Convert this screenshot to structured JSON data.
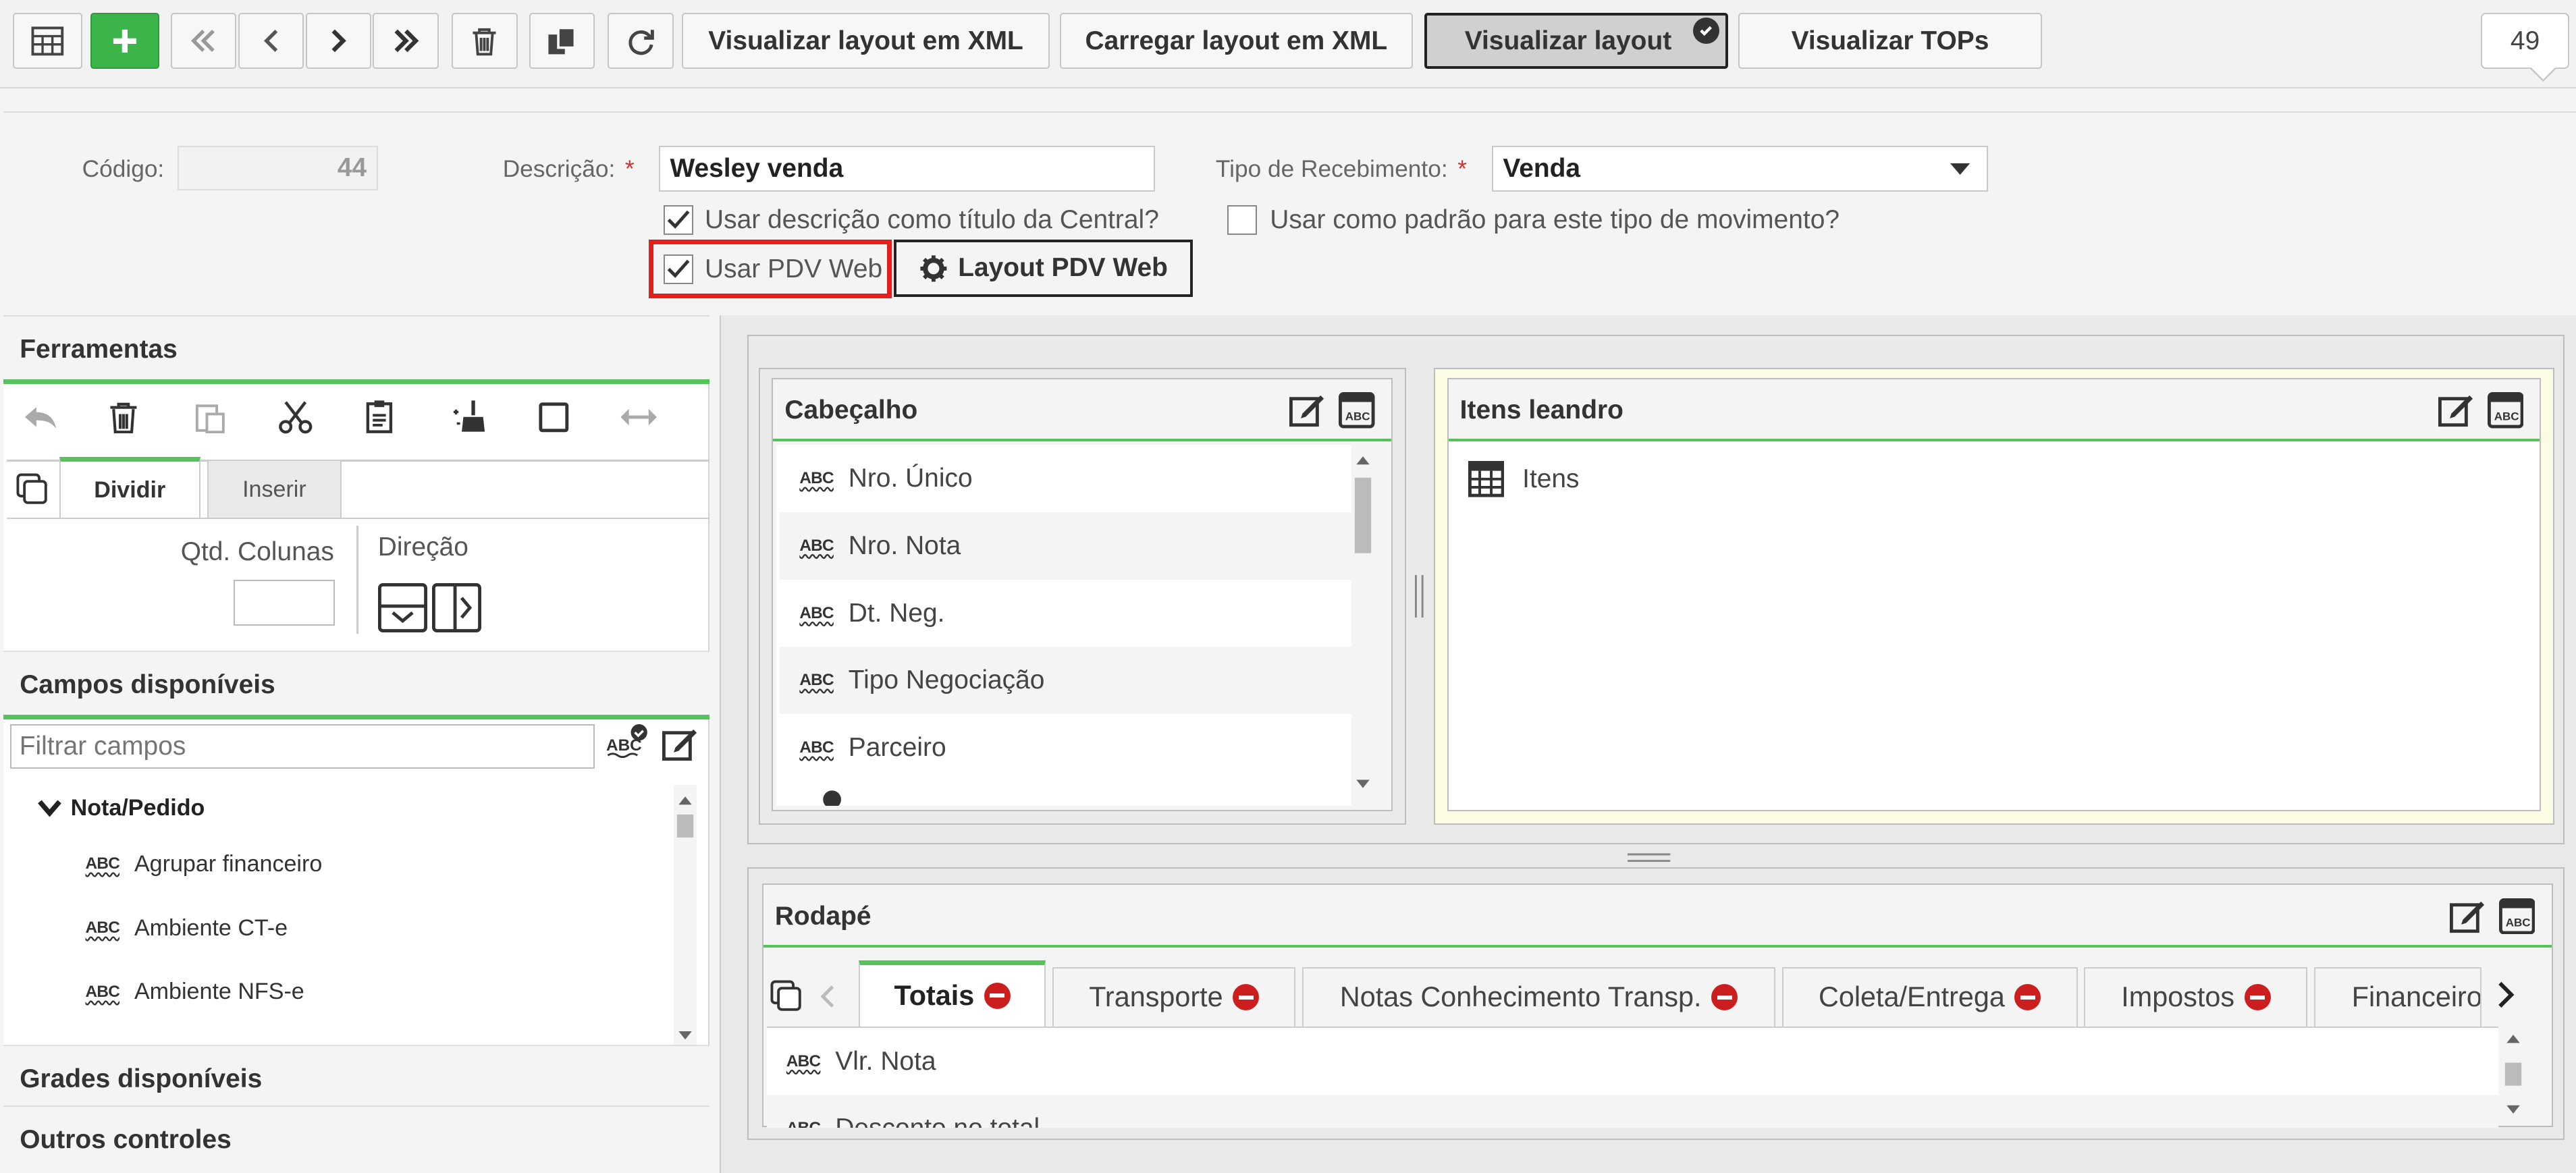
{
  "toolbar": {
    "view_xml_label": "Visualizar layout em XML",
    "load_xml_label": "Carregar layout em XML",
    "view_layout_label": "Visualizar layout",
    "view_tops_label": "Visualizar TOPs",
    "count": "49",
    "icons": [
      "grid-icon",
      "add-icon",
      "first-icon",
      "prev-icon",
      "next-icon",
      "last-icon",
      "trash-icon",
      "copy-icon",
      "refresh-icon"
    ]
  },
  "form": {
    "codigo_label": "Código:",
    "codigo_value": "44",
    "descricao_label": "Descrição:",
    "descricao_value": "Wesley venda",
    "tipo_label": "Tipo de Recebimento:",
    "tipo_value": "Venda",
    "required_mark": "*",
    "chk_titulo": "Usar descrição como título da Central?",
    "chk_padrao": "Usar como padrão para este tipo de movimento?",
    "chk_pdv": "Usar PDV Web",
    "layout_pdv_button": "Layout PDV Web"
  },
  "left": {
    "ferramentas_title": "Ferramentas",
    "tab_dividir": "Dividir",
    "tab_inserir": "Inserir",
    "qtd_colunas_label": "Qtd. Colunas",
    "direcao_label": "Direção",
    "campos_title": "Campos disponíveis",
    "filter_placeholder": "Filtrar campos",
    "group_label": "Nota/Pedido",
    "fields": [
      "Agrupar financeiro",
      "Ambiente CT-e",
      "Ambiente NFS-e"
    ],
    "grades_title": "Grades disponíveis",
    "outros_title": "Outros controles"
  },
  "cabecalho": {
    "title": "Cabeçalho",
    "fields": [
      "Nro. Único",
      "Nro. Nota",
      "Dt. Neg.",
      "Tipo Negociação",
      "Parceiro"
    ]
  },
  "itens": {
    "title": "Itens leandro",
    "item_label": "Itens"
  },
  "rodape": {
    "title": "Rodapé",
    "tabs": [
      "Totais",
      "Transporte",
      "Notas Conhecimento Transp.",
      "Coleta/Entrega",
      "Impostos",
      "Financeiro"
    ],
    "fields": [
      "Vlr. Nota",
      "Desconto no total"
    ]
  },
  "abc_label": "ABC",
  "colors": {
    "accent_green": "#55c35a",
    "add_green": "#3bb54a",
    "highlight_red": "#e0201b",
    "remove_red": "#cc1e1e"
  }
}
